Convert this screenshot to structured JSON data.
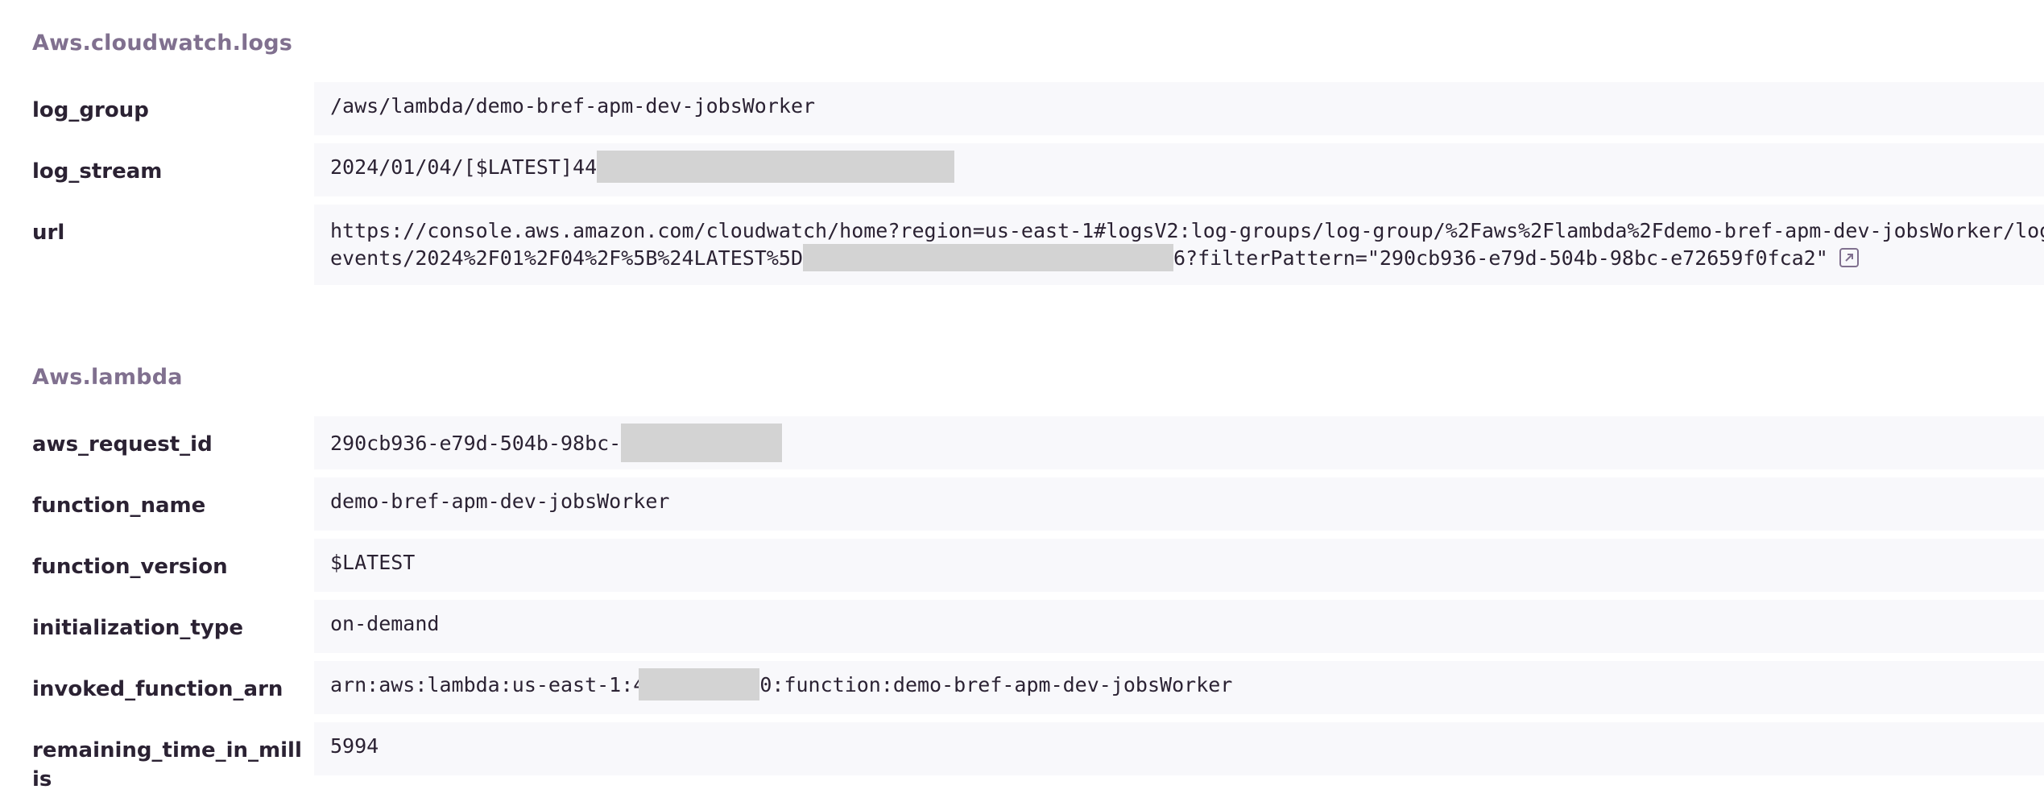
{
  "sections": [
    {
      "title": "Aws.cloudwatch.logs",
      "rows": [
        {
          "key": "log_group",
          "value": "/aws/lambda/demo-bref-apm-dev-jobsWorker"
        },
        {
          "key": "log_stream",
          "value_prefix": "2024/01/04/[$LATEST]44"
        },
        {
          "key": "url",
          "value_line1": "https://console.aws.amazon.com/cloudwatch/home?region=us-east-1#logsV2:log-groups/log-group/%2Faws%2Flambda%2Fdemo-bref-apm-dev-jobsWorker/log-",
          "value_line2_prefix": "events/2024%2F01%2F04%2F%5B%24LATEST%5D",
          "value_line2_suffix": "6?filterPattern=\"290cb936-e79d-504b-98bc-e72659f0fca2\"",
          "link_icon": "external-link-icon"
        }
      ]
    },
    {
      "title": "Aws.lambda",
      "rows": [
        {
          "key": "aws_request_id",
          "value_prefix": "290cb936-e79d-504b-98bc-"
        },
        {
          "key": "function_name",
          "value": "demo-bref-apm-dev-jobsWorker"
        },
        {
          "key": "function_version",
          "value": "$LATEST"
        },
        {
          "key": "initialization_type",
          "value": "on-demand"
        },
        {
          "key": "invoked_function_arn",
          "value_prefix": "arn:aws:lambda:us-east-1:4",
          "value_suffix": "0:function:demo-bref-apm-dev-jobsWorker"
        },
        {
          "key": "remaining_time_in_millis",
          "value": "5994"
        }
      ]
    }
  ],
  "colors": {
    "section_title": "#80708f",
    "key_text": "#2b2233",
    "value_bg": "#f8f8fb",
    "redaction": "#d3d3d3"
  }
}
